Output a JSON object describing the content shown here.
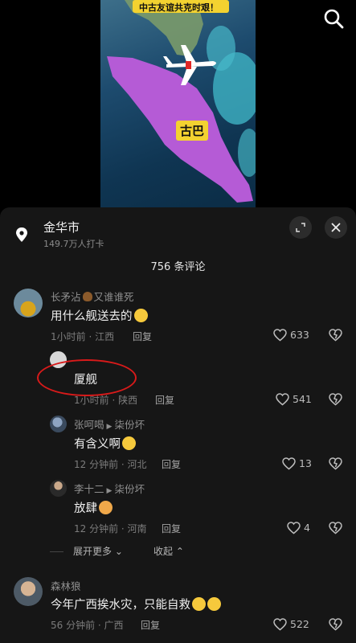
{
  "video": {
    "banner_line": "中古友谊共克时艰！",
    "map_label": "古巴"
  },
  "location": {
    "name": "金华市",
    "checkins": "149.7万人打卡"
  },
  "comments_header": {
    "count": "756 条评论"
  },
  "comments": [
    {
      "user": "长矛沾",
      "user_suffix": "又谁谁死",
      "text": "用什么舰送去的",
      "meta": "1小时前 · 江西",
      "reply": "回复",
      "likes": "633"
    },
    {
      "user": "",
      "text": "厦舰",
      "meta": "1小时前 · 陕西",
      "reply": "回复",
      "likes": "541"
    },
    {
      "user": "张呵喝",
      "reply_to": "柒份坏",
      "text": "有含义啊",
      "meta": "12 分钟前 · 河北",
      "reply": "回复",
      "likes": "13"
    },
    {
      "user": "李十二",
      "reply_to": "柒份坏",
      "text": "放肆",
      "meta": "12 分钟前 · 河南",
      "reply": "回复",
      "likes": "4"
    },
    {
      "user": "森林狼",
      "text": "今年广西挨水灾，只能自救",
      "meta": "56 分钟前 · 广西",
      "reply": "回复",
      "likes": "522"
    }
  ],
  "thread_controls": {
    "expand": "展开更多",
    "collapse": "收起"
  },
  "colors": {
    "panel_bg": "#161616",
    "highlight_ring": "#d81a1a",
    "map_land": "#b55bd6"
  }
}
